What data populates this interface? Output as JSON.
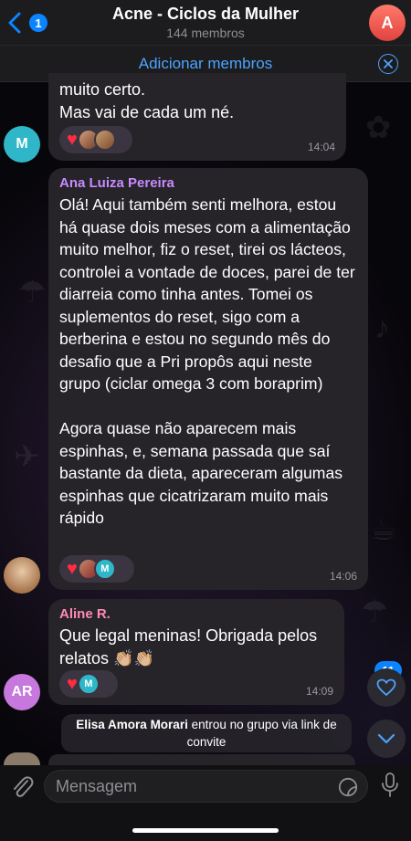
{
  "header": {
    "back_badge": "1",
    "title": "Acne - Ciclos da Mulher",
    "subtitle": "144 membros",
    "avatar_letter": "A"
  },
  "add_members": {
    "label": "Adicionar membros"
  },
  "messages": [
    {
      "text": "muito certo.\nMas vai de cada um né.",
      "time": "14:04",
      "avatar_letter": "M",
      "avatar_color": "#2fb7c9",
      "reaction_letters": [
        "",
        ""
      ]
    },
    {
      "sender": "Ana Luiza Pereira",
      "sender_color": "#c88bff",
      "text": "Olá! Aqui também senti melhora, estou há quase dois meses com a alimentação muito melhor, fiz o reset, tirei os lácteos, controlei a vontade de doces, parei de ter diarreia como tinha antes. Tomei os suplementos do reset, sigo com a berberina e estou no segundo mês do desafio que a Pri propôs aqui neste grupo (ciclar omega 3 com boraprim)\n\nAgora quase não aparecem mais espinhas, e, semana passada que saí bastante da dieta, apareceram algumas espinhas que cicatrizaram muito mais rápido",
      "time": "14:06",
      "reaction_letters": [
        "",
        "M"
      ]
    },
    {
      "sender": "Aline R.",
      "sender_color": "#ff8ab4",
      "text": "Que legal meninas! Obrigada pelos relatos 👏🏼👏🏼",
      "time": "14:09",
      "avatar_letter": "AR",
      "avatar_color": "#c678dd",
      "reaction_letters": [
        "M"
      ]
    }
  ],
  "system": {
    "name": "Elisa Amora Morari",
    "text": "entrou no grupo via link de convite"
  },
  "unread_badge": "11",
  "input": {
    "placeholder": "Mensagem"
  },
  "colors": {
    "accent": "#0a84ff",
    "heart": "#ff2d3f",
    "link": "#4da3ff"
  },
  "icons": [
    "back-chevron-icon",
    "close-circle-icon",
    "heart-icon",
    "chevron-down-icon",
    "paperclip-icon",
    "sticker-icon",
    "microphone-icon"
  ]
}
